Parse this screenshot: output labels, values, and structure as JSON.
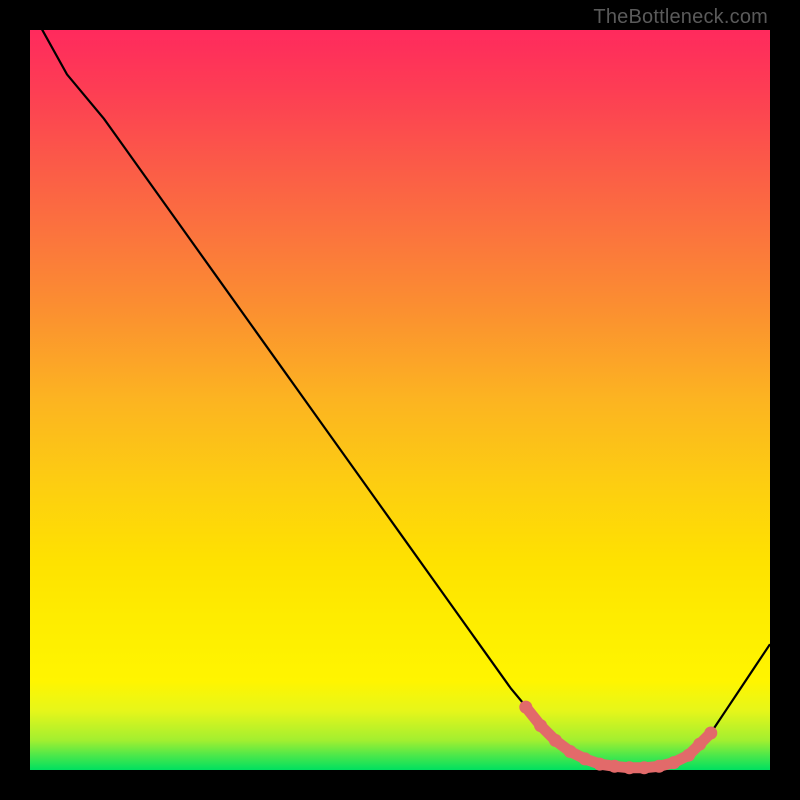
{
  "attribution": "TheBottleneck.com",
  "chart_data": {
    "type": "line",
    "title": "",
    "xlabel": "",
    "ylabel": "",
    "xlim": [
      0,
      100
    ],
    "ylim": [
      0,
      100
    ],
    "series": [
      {
        "name": "bottleneck-curve",
        "x": [
          0,
          5,
          10,
          15,
          20,
          25,
          30,
          35,
          40,
          45,
          50,
          55,
          60,
          65,
          70,
          72,
          74,
          76,
          78,
          80,
          82,
          84,
          86,
          88,
          90,
          92,
          94,
          96,
          98,
          100
        ],
        "values": [
          103,
          94,
          88,
          81,
          74,
          67,
          60,
          53,
          46,
          39,
          32,
          25,
          18,
          11,
          5,
          3,
          1.5,
          0.8,
          0.4,
          0.3,
          0.3,
          0.4,
          0.8,
          1.5,
          3,
          5,
          8,
          11,
          14,
          17
        ]
      }
    ],
    "highlight": {
      "color": "#e26a6a",
      "x": [
        67,
        69,
        71,
        73,
        75,
        77,
        79,
        81,
        83,
        85,
        87,
        89,
        90.5,
        92
      ],
      "values": [
        8.5,
        6,
        4,
        2.5,
        1.5,
        0.8,
        0.5,
        0.3,
        0.3,
        0.5,
        1,
        2,
        3.5,
        5
      ]
    },
    "background_gradient": {
      "bottom": "#00e060",
      "mid": "#fee200",
      "top": "#ff2a5d"
    }
  }
}
